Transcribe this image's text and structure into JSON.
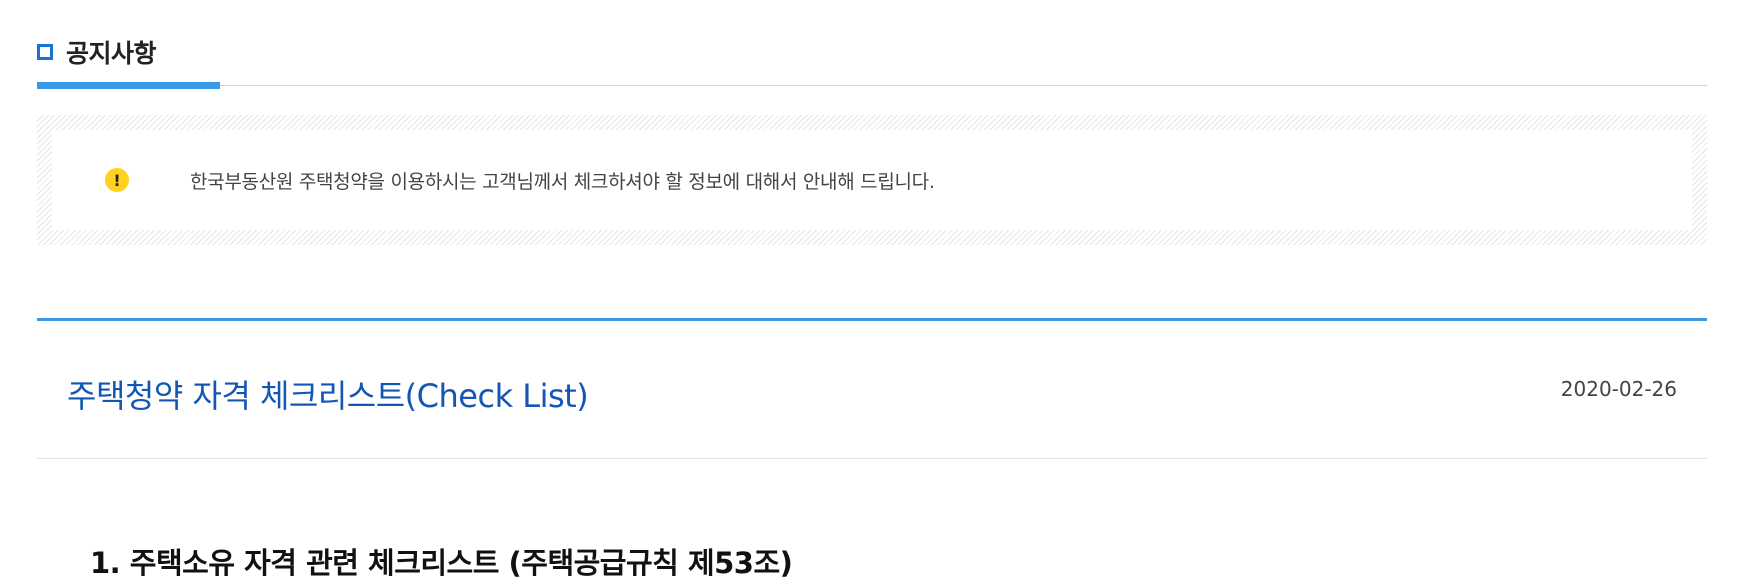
{
  "section": {
    "title": "공지사항",
    "title_icon": "square-bullet-icon",
    "accent_color": "#3b9ae8"
  },
  "notice": {
    "icon": "exclamation-icon",
    "icon_color": "#ffd21f",
    "text": "한국부동산원 주택청약을 이용하시는 고객님께서 체크하셔야 할 정보에 대해서 안내해 드립니다."
  },
  "post": {
    "title": "주택청약 자격 체크리스트(Check List)",
    "title_color": "#1357b6",
    "date": "2020-02-26"
  },
  "article": {
    "heading": "1. 주택소유 자격 관련 체크리스트 (주택공급규칙 제53조)"
  }
}
